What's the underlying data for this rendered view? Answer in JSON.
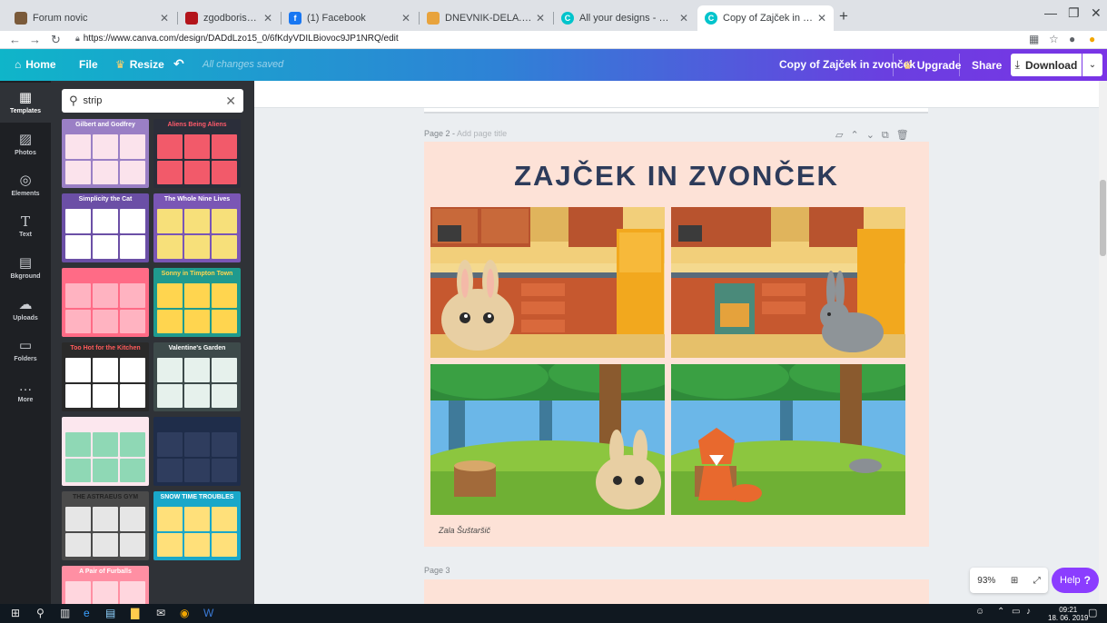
{
  "browser": {
    "tabs": [
      {
        "title": "Forum novic",
        "favicon_color": "#7a5a3a"
      },
      {
        "title": "zgodboris_PN_Šuštaršič_Rakove...",
        "favicon_color": "#b3141b"
      },
      {
        "title": "(1) Facebook",
        "favicon_color": "#1877f2"
      },
      {
        "title": "DNEVNIK-DELA.pdf",
        "favicon_color": "#e8a33d"
      },
      {
        "title": "All your designs - Canva",
        "favicon_color": "#00c4cc"
      },
      {
        "title": "Copy of Zajček in zvonček",
        "favicon_color": "#00c4cc"
      }
    ],
    "url": "https://www.canva.com/design/DADdLzo15_0/6fKdyVDILBiovoc9JP1NRQ/edit"
  },
  "header": {
    "home": "Home",
    "file": "File",
    "resize": "Resize",
    "saved_status": "All changes saved",
    "design_title": "Copy of Zajček in zvonček",
    "upgrade": "Upgrade",
    "share": "Share",
    "download": "Download"
  },
  "rail": [
    {
      "label": "Templates",
      "icon": "▦"
    },
    {
      "label": "Photos",
      "icon": "▨"
    },
    {
      "label": "Elements",
      "icon": "◎"
    },
    {
      "label": "Text",
      "icon": "T"
    },
    {
      "label": "Bkground",
      "icon": "▤"
    },
    {
      "label": "Uploads",
      "icon": "☁"
    },
    {
      "label": "Folders",
      "icon": "▭"
    },
    {
      "label": "More",
      "icon": "…"
    }
  ],
  "panel": {
    "search_value": "strip",
    "templates": [
      {
        "title": "Gilbert and Godfrey",
        "bg": "#9a7fc5",
        "fg": "#ffffff",
        "cell": "#fbe3ec"
      },
      {
        "title": "Aliens Being Aliens",
        "bg": "#2b2e3a",
        "fg": "#ff5a6a",
        "cell": "#f25a6a"
      },
      {
        "title": "Simplicity the Cat",
        "bg": "#6b4fa6",
        "fg": "#ffffff",
        "cell": "#ffffff"
      },
      {
        "title": "The Whole Nine Lives",
        "bg": "#7a56b5",
        "fg": "#ffffff",
        "cell": "#f7e07a"
      },
      {
        "title": "",
        "bg": "#ff6b86",
        "fg": "#ffffff",
        "cell": "#ffb3c1"
      },
      {
        "title": "Sonny in Timpton Town",
        "bg": "#1f9a8e",
        "fg": "#ffd54f",
        "cell": "#ffd54f"
      },
      {
        "title": "Too Hot for the Kitchen",
        "bg": "#2a2a2a",
        "fg": "#ff5a5a",
        "cell": "#ffffff"
      },
      {
        "title": "Valentine's Garden",
        "bg": "#3d4a4a",
        "fg": "#ffffff",
        "cell": "#e6f1ec"
      },
      {
        "title": "",
        "bg": "#fce7ee",
        "fg": "#333333",
        "cell": "#8fd8b5"
      },
      {
        "title": "",
        "bg": "#1f2d4a",
        "fg": "#ffffff",
        "cell": "#2f3d5e"
      },
      {
        "title": "THE ASTRAEUS GYM",
        "bg": "#4a4a4a",
        "fg": "#222222",
        "cell": "#e6e6e6"
      },
      {
        "title": "SNOW TIME TROUBLES",
        "bg": "#19a7c9",
        "fg": "#ffffff",
        "cell": "#ffe07a"
      },
      {
        "title": "A Pair of Furballs",
        "bg": "#ff8fa3",
        "fg": "#ffffff",
        "cell": "#ffd6de"
      }
    ]
  },
  "canvas": {
    "page2_label": "Page 2 - ",
    "page2_hint": "Add page title",
    "page3_label": "Page 3",
    "title": "ZAJČEK IN ZVONČEK",
    "author": "Zala Šuštaršič"
  },
  "zoom": "93%",
  "help": "Help",
  "taskbar": {
    "time": "09:21",
    "date": "18. 06. 2019"
  }
}
